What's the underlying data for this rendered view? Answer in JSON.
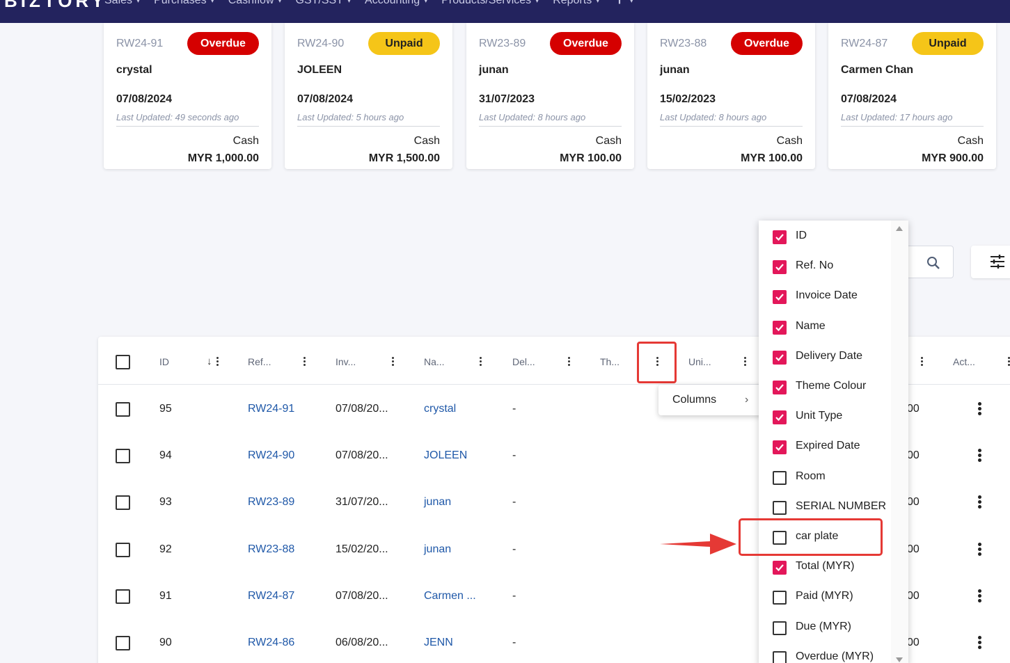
{
  "nav": {
    "brand": "BIZTORY",
    "items": [
      "Sales",
      "Purchases",
      "Cashflow",
      "GST/SST",
      "Accounting",
      "Products/Services",
      "Reports"
    ]
  },
  "cards": [
    {
      "ref": "RW24-91",
      "status": "Overdue",
      "name": "crystal",
      "date": "07/08/2024",
      "updated": "Last Updated: 49 seconds ago",
      "method": "Cash",
      "amount": "MYR 1,000.00"
    },
    {
      "ref": "RW24-90",
      "status": "Unpaid",
      "name": "JOLEEN",
      "date": "07/08/2024",
      "updated": "Last Updated: 5 hours ago",
      "method": "Cash",
      "amount": "MYR 1,500.00"
    },
    {
      "ref": "RW23-89",
      "status": "Overdue",
      "name": "junan",
      "date": "31/07/2023",
      "updated": "Last Updated: 8 hours ago",
      "method": "Cash",
      "amount": "MYR 100.00"
    },
    {
      "ref": "RW23-88",
      "status": "Overdue",
      "name": "junan",
      "date": "15/02/2023",
      "updated": "Last Updated: 8 hours ago",
      "method": "Cash",
      "amount": "MYR 100.00"
    },
    {
      "ref": "RW24-87",
      "status": "Unpaid",
      "name": "Carmen Chan",
      "date": "07/08/2024",
      "updated": "Last Updated: 17 hours ago",
      "method": "Cash",
      "amount": "MYR 900.00"
    }
  ],
  "table": {
    "headers": [
      "ID",
      "Ref...",
      "Inv...",
      "Na...",
      "Del...",
      "Th...",
      "Uni...",
      "Act..."
    ],
    "rows": [
      {
        "id": "95",
        "ref": "RW24-91",
        "inv": "07/08/20...",
        "name": "crystal",
        "del": "-",
        "total": "00"
      },
      {
        "id": "94",
        "ref": "RW24-90",
        "inv": "07/08/20...",
        "name": "JOLEEN",
        "del": "-",
        "total": "00"
      },
      {
        "id": "93",
        "ref": "RW23-89",
        "inv": "31/07/20...",
        "name": "junan",
        "del": "-",
        "total": "00"
      },
      {
        "id": "92",
        "ref": "RW23-88",
        "inv": "15/02/20...",
        "name": "junan",
        "del": "-",
        "total": "00"
      },
      {
        "id": "91",
        "ref": "RW24-87",
        "inv": "07/08/20...",
        "name": "Carmen ...",
        "del": "-",
        "total": "00"
      },
      {
        "id": "90",
        "ref": "RW24-86",
        "inv": "06/08/20...",
        "name": "JENN",
        "del": "-",
        "total": "00"
      }
    ]
  },
  "context_menu": {
    "label": "Columns"
  },
  "columns_panel": [
    {
      "label": "ID",
      "checked": true
    },
    {
      "label": "Ref. No",
      "checked": true
    },
    {
      "label": "Invoice Date",
      "checked": true
    },
    {
      "label": "Name",
      "checked": true
    },
    {
      "label": "Delivery Date",
      "checked": true
    },
    {
      "label": "Theme Colour",
      "checked": true
    },
    {
      "label": "Unit Type",
      "checked": true
    },
    {
      "label": "Expired Date",
      "checked": true
    },
    {
      "label": "Room",
      "checked": false
    },
    {
      "label": "SERIAL NUMBER",
      "checked": false
    },
    {
      "label": "car plate",
      "checked": false
    },
    {
      "label": "Total (MYR)",
      "checked": true
    },
    {
      "label": "Paid (MYR)",
      "checked": false
    },
    {
      "label": "Due (MYR)",
      "checked": false
    },
    {
      "label": "Overdue (MYR)",
      "checked": false
    }
  ],
  "colors": {
    "nav": "#23235e",
    "overdue": "#d50000",
    "unpaid": "#f5c518",
    "checkbox": "#e3175a",
    "link": "#1f58a8",
    "annotation": "#e53935"
  }
}
